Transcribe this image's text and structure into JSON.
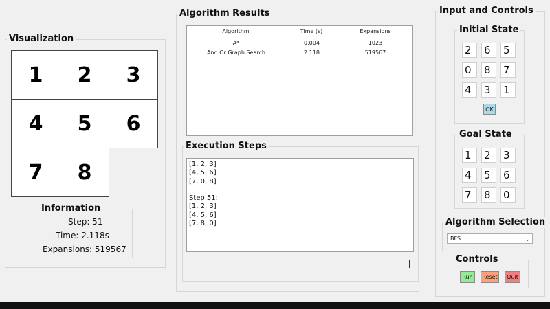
{
  "visualization": {
    "title": "Visualization",
    "board": [
      "1",
      "2",
      "3",
      "4",
      "5",
      "6",
      "7",
      "8",
      ""
    ]
  },
  "information": {
    "title": "Information",
    "step": "Step: 51",
    "time": "Time: 2.118s",
    "expansions": "Expansions: 519567"
  },
  "results": {
    "title": "Algorithm Results",
    "headers": [
      "Algorithm",
      "Time (s)",
      "Expansions"
    ],
    "rows": [
      [
        "A*",
        "0.004",
        "1023"
      ],
      [
        "And Or Graph Search",
        "2.118",
        "519567"
      ]
    ]
  },
  "steps": {
    "title": "Execution Steps",
    "text": "[1, 2, 3]\n[4, 5, 6]\n[7, 0, 8]\n\nStep 51:\n[1, 2, 3]\n[4, 5, 6]\n[7, 8, 0]"
  },
  "controls_panel": {
    "title": "Input and Controls",
    "initial": {
      "title": "Initial State",
      "values": [
        "2",
        "6",
        "5",
        "0",
        "8",
        "7",
        "4",
        "3",
        "1"
      ],
      "ok_label": "OK"
    },
    "goal": {
      "title": "Goal State",
      "values": [
        "1",
        "2",
        "3",
        "4",
        "5",
        "6",
        "7",
        "8",
        "0"
      ]
    },
    "algorithm": {
      "title": "Algorithm Selection",
      "selected": "BFS"
    },
    "controls": {
      "title": "Controls",
      "run_label": "Run",
      "reset_label": "Reset",
      "quit_label": "Quit"
    }
  },
  "colors": {
    "run": "#90ee90",
    "reset": "#ffa07a",
    "quit": "#f08080",
    "ok": "#add8e6"
  }
}
